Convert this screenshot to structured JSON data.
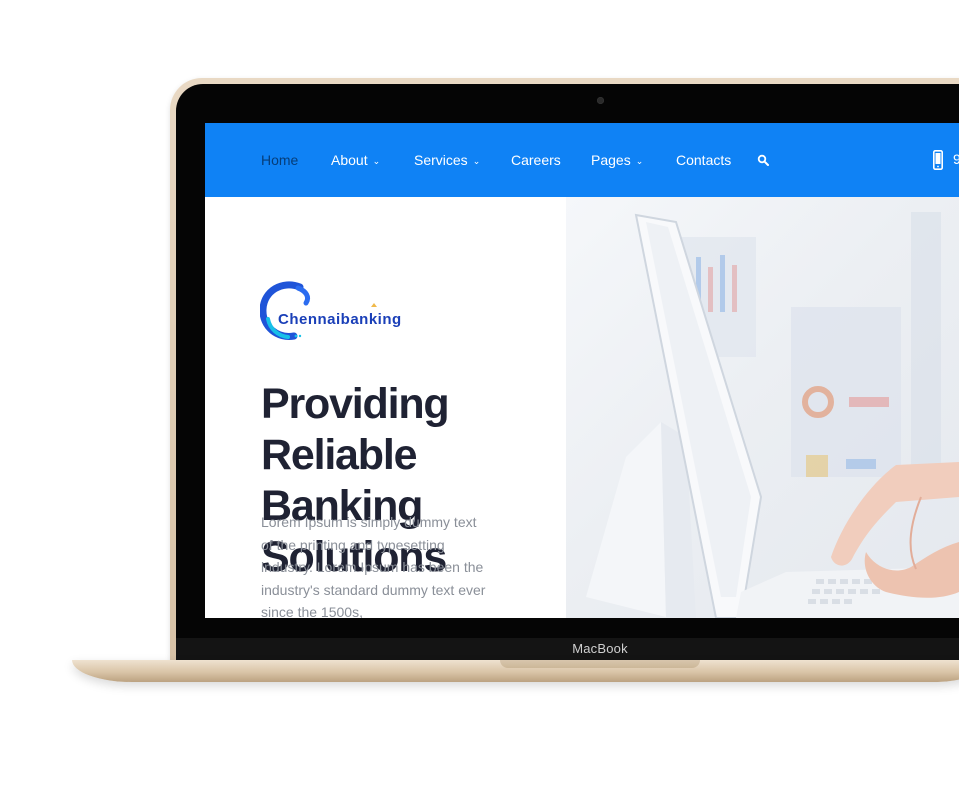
{
  "device": {
    "brand": "MacBook"
  },
  "nav": {
    "items": [
      {
        "label": "Home",
        "active": true,
        "dropdown": false
      },
      {
        "label": "About",
        "active": false,
        "dropdown": true
      },
      {
        "label": "Services",
        "active": false,
        "dropdown": true
      },
      {
        "label": "Careers",
        "active": false,
        "dropdown": false
      },
      {
        "label": "Pages",
        "active": false,
        "dropdown": true
      },
      {
        "label": "Contacts",
        "active": false,
        "dropdown": false
      }
    ],
    "search_icon": "search-icon",
    "phone_icon": "mobile-phone-icon",
    "phone_partial": "9"
  },
  "hero": {
    "logo_text": "Chennaibanking",
    "title_line1": "Providing Reliable",
    "title_line2": "Banking Solutions",
    "text": "Lorem Ipsum is simply dummy text of the printing and typesetting industry. Lorem Ipsum has been the industry's standard dummy text ever since the 1500s,"
  },
  "colors": {
    "nav_bg": "#0f82f5",
    "active_nav": "#063d78",
    "title": "#1f2233",
    "body_text": "#8a8f98",
    "logo_blue": "#1a3fb8"
  }
}
